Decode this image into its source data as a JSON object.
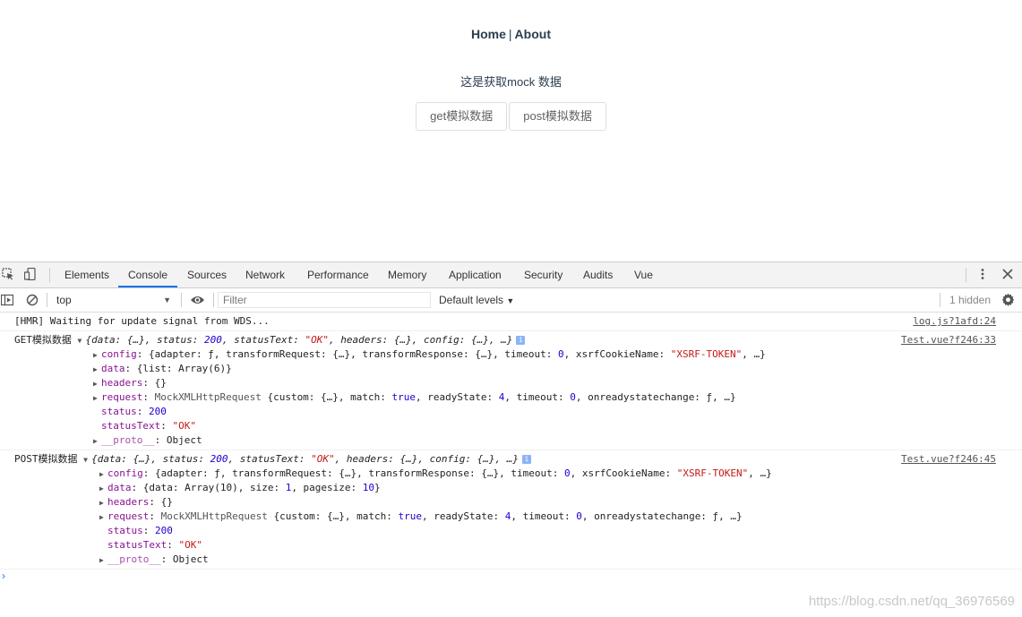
{
  "nav": {
    "home": "Home",
    "sep": "|",
    "about": "About"
  },
  "lead": "这是获取mock 数据",
  "buttons": {
    "get": "get模拟数据",
    "post": "post模拟数据"
  },
  "devtools": {
    "tabs": [
      "Elements",
      "Console",
      "Sources",
      "Network",
      "Performance",
      "Memory",
      "Application",
      "Security",
      "Audits",
      "Vue"
    ],
    "active_tab": "Console",
    "context": "top",
    "filter_placeholder": "Filter",
    "levels": "Default levels",
    "hidden": "1 hidden"
  },
  "console": {
    "hmr": {
      "text": "[HMR] Waiting for update signal from WDS...",
      "src": "log.js?1afd:24"
    },
    "get": {
      "label": "GET模拟数据",
      "src": "Test.vue?f246:33",
      "summary": [
        "{data: {…}, status: ",
        "200",
        ", statusText: ",
        "\"OK\"",
        ", headers: {…}, config: {…}, …}"
      ],
      "config": [
        "config",
        ": {adapter: ƒ, transformRequest: {…}, transformResponse: {…}, timeout: ",
        "0",
        ", xsrfCookieName: ",
        "\"XSRF-TOKEN\"",
        ", …}"
      ],
      "data": [
        "data",
        ": {list: Array(6)}"
      ],
      "headers": [
        "headers",
        ": {}"
      ],
      "request": [
        "request",
        ": ",
        "MockXMLHttpRequest",
        " {custom: {…}, match: ",
        "true",
        ", readyState: ",
        "4",
        ", timeout: ",
        "0",
        ", onreadystatechange: ƒ, …}"
      ],
      "status": [
        "status",
        ": ",
        "200"
      ],
      "statusText": [
        "statusText",
        ": ",
        "\"OK\""
      ],
      "proto": [
        "__proto__",
        ": Object"
      ]
    },
    "post": {
      "label": "POST模拟数据",
      "src": "Test.vue?f246:45",
      "summary": [
        "{data: {…}, status: ",
        "200",
        ", statusText: ",
        "\"OK\"",
        ", headers: {…}, config: {…}, …}"
      ],
      "config": [
        "config",
        ": {adapter: ƒ, transformRequest: {…}, transformResponse: {…}, timeout: ",
        "0",
        ", xsrfCookieName: ",
        "\"XSRF-TOKEN\"",
        ", …}"
      ],
      "data": [
        "data",
        ": {data: Array(10), size: ",
        "1",
        ", pagesize: ",
        "10",
        "}"
      ],
      "headers": [
        "headers",
        ": {}"
      ],
      "request": [
        "request",
        ": ",
        "MockXMLHttpRequest",
        " {custom: {…}, match: ",
        "true",
        ", readyState: ",
        "4",
        ", timeout: ",
        "0",
        ", onreadystatechange: ƒ, …}"
      ],
      "status": [
        "status",
        ": ",
        "200"
      ],
      "statusText": [
        "statusText",
        ": ",
        "\"OK\""
      ],
      "proto": [
        "__proto__",
        ": Object"
      ]
    }
  },
  "watermark": "https://blog.csdn.net/qq_36976569",
  "colors": {
    "accent": "#1a73e8",
    "string": "#c41a16",
    "number": "#1c00cf",
    "key": "#881391",
    "nav_text": "#2c3e50"
  }
}
